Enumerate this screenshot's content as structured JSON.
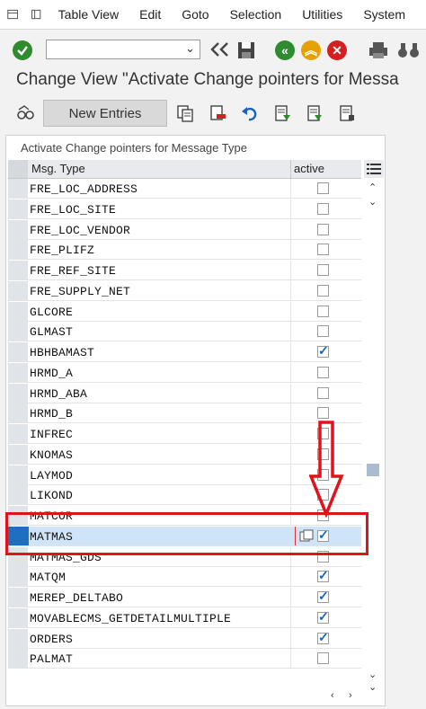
{
  "menu": {
    "items": [
      "Table View",
      "Edit",
      "Goto",
      "Selection",
      "Utilities",
      "System"
    ]
  },
  "toolbar": {
    "command_value": ""
  },
  "page": {
    "title": "Change View \"Activate Change pointers for Messa"
  },
  "app_toolbar": {
    "new_entries_label": "New Entries"
  },
  "table": {
    "title": "Activate Change pointers for Message Type",
    "col_msg_type": "Msg. Type",
    "col_active": "active",
    "rows": [
      {
        "name": "FRE_LOC_ADDRESS",
        "active": false
      },
      {
        "name": "FRE_LOC_SITE",
        "active": false
      },
      {
        "name": "FRE_LOC_VENDOR",
        "active": false
      },
      {
        "name": "FRE_PLIFZ",
        "active": false
      },
      {
        "name": "FRE_REF_SITE",
        "active": false
      },
      {
        "name": "FRE_SUPPLY_NET",
        "active": false
      },
      {
        "name": "GLCORE",
        "active": false
      },
      {
        "name": "GLMAST",
        "active": false
      },
      {
        "name": "HBHBAMAST",
        "active": true
      },
      {
        "name": "HRMD_A",
        "active": false
      },
      {
        "name": "HRMD_ABA",
        "active": false
      },
      {
        "name": "HRMD_B",
        "active": false
      },
      {
        "name": "INFREC",
        "active": false
      },
      {
        "name": "KNOMAS",
        "active": false
      },
      {
        "name": "LAYMOD",
        "active": false
      },
      {
        "name": "LIKOND",
        "active": false
      },
      {
        "name": "MATCOR",
        "active": false
      },
      {
        "name": "MATMAS",
        "active": true,
        "selected": true
      },
      {
        "name": "MATMAS_GDS",
        "active": false
      },
      {
        "name": "MATQM",
        "active": true
      },
      {
        "name": "MEREP_DELTABO",
        "active": true
      },
      {
        "name": "MOVABLECMS_GETDETAILMULTIPLE",
        "active": true
      },
      {
        "name": "ORDERS",
        "active": true
      },
      {
        "name": "PALMAT",
        "active": false
      }
    ]
  },
  "colors": {
    "highlight": "#e0121b",
    "selected_row": "#cfe5f7",
    "checkmark": "#1565c0"
  }
}
